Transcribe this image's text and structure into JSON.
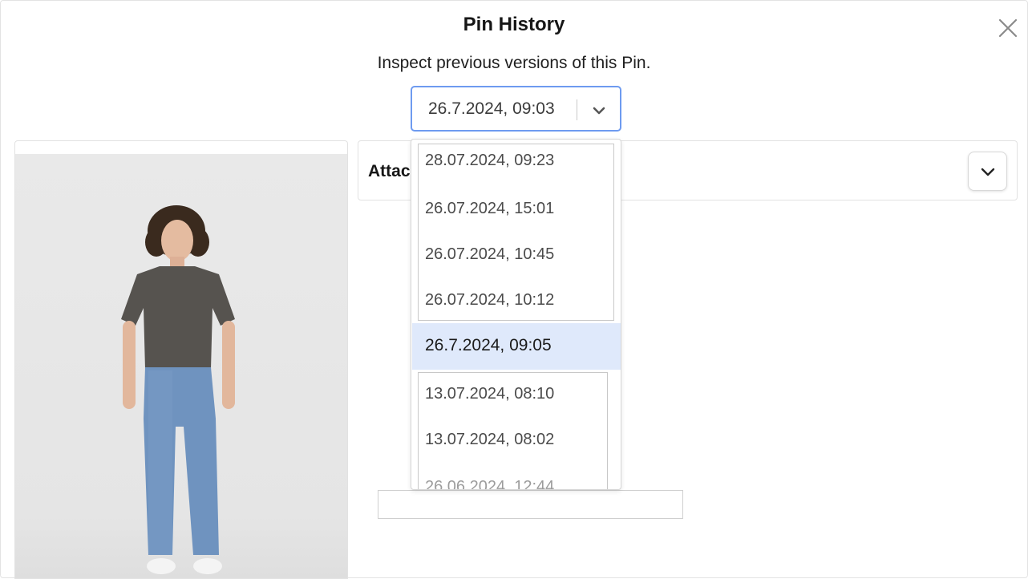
{
  "dialog": {
    "title": "Pin History",
    "subtitle": "Inspect previous versions of this Pin.",
    "close_icon": "close-icon"
  },
  "version_select": {
    "value": "26.7.2024, 09:03",
    "chevron_icon": "chevron-down-icon"
  },
  "dropdown": {
    "options": [
      "28.07.2024, 09:23",
      "26.07.2024, 15:01",
      "26.07.2024, 10:45",
      "26.07.2024, 10:12",
      "26.7.2024, 09:05",
      "13.07.2024, 08:10",
      "13.07.2024, 08:02",
      "26.06.2024, 12:44"
    ],
    "selected_index": 4,
    "highlight_color": "#dfe9fb"
  },
  "attachments": {
    "label": "Attac",
    "toggle_icon": "chevron-down-icon"
  },
  "colors": {
    "focus_border": "#6e9bf0"
  }
}
